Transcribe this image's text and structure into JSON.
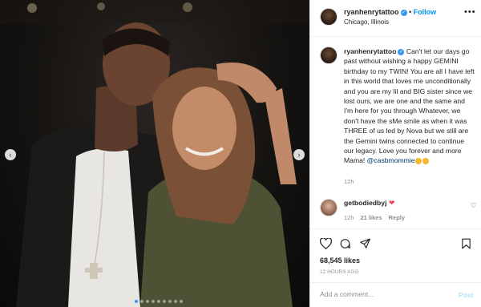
{
  "post": {
    "username": "ryanhenrytattoo",
    "follow_label": "Follow",
    "separator": "•",
    "location": "Chicago, Illinois",
    "more_label": "•••",
    "verified_mark": "✓",
    "caption_text": "Can't let our days go past without wishing a happy GEMINI birthday to my TWIN! You are all I have left in this world that loves me unconditionally and you are my lil and BIG sister since we lost ours, we are one and the same and I'm here for you through Whatever, we don't have the sMe smile as when it was THREE of us led by Nova but we still are the Gemini twins connected to continue our legacy. Love you forever and more Mama!",
    "caption_mention": "@casbmommie",
    "caption_time": "12h",
    "likes": "68,545 likes",
    "posted_ago": "12 HOURS AGO"
  },
  "comment": {
    "username": "getbodiedbyj",
    "text": "❤",
    "time": "12h",
    "likes": "21 likes",
    "reply_label": "Reply",
    "like_icon": "♡"
  },
  "add_comment": {
    "placeholder": "Add a comment...",
    "post_label": "Post"
  },
  "carousel": {
    "prev_icon": "‹",
    "next_icon": "›",
    "dot_count": 9,
    "active_index": 0
  },
  "colors": {
    "accent": "#0095f6",
    "verified": "#3897f0",
    "heart": "#ed4956",
    "post_disabled": "#b2dffc"
  }
}
